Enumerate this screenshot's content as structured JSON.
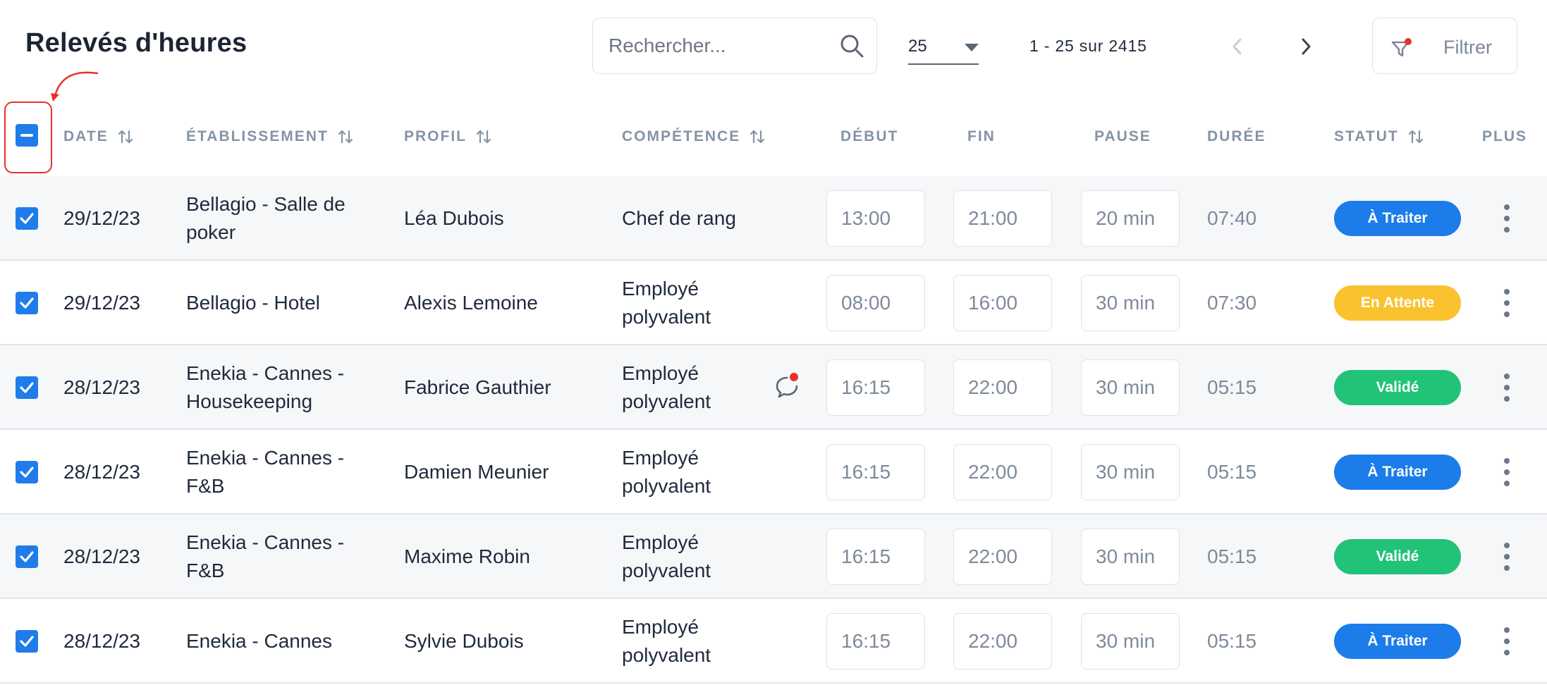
{
  "page": {
    "title": "Relevés d'heures"
  },
  "search": {
    "placeholder": "Rechercher..."
  },
  "pagination": {
    "per_page": "25",
    "range": "1 - 25 sur 2415"
  },
  "filter": {
    "label": "Filtrer"
  },
  "columns": {
    "date": "DATE",
    "etablissement": "ÉTABLISSEMENT",
    "profil": "PROFIL",
    "competence": "COMPÉTENCE",
    "debut": "DÉBUT",
    "fin": "FIN",
    "pause": "PAUSE",
    "duree": "DURÉE",
    "statut": "STATUT",
    "plus": "PLUS"
  },
  "colors": {
    "accent": "#1f7cea",
    "a_traiter": "#1b7cea",
    "en_attente": "#f9c22e",
    "valide": "#21c379",
    "annotation": "#e5322b"
  },
  "rows": [
    {
      "date": "29/12/23",
      "etab": "Bellagio - Salle de poker",
      "profil": "Léa Dubois",
      "comp": "Chef de rang",
      "debut": "13:00",
      "fin": "21:00",
      "pause": "20 min",
      "duree": "07:40",
      "statut": "À Traiter",
      "status_key": "a_traiter",
      "checked": true,
      "has_comment": false
    },
    {
      "date": "29/12/23",
      "etab": "Bellagio - Hotel",
      "profil": "Alexis Lemoine",
      "comp": "Employé polyvalent",
      "debut": "08:00",
      "fin": "16:00",
      "pause": "30 min",
      "duree": "07:30",
      "statut": "En Attente",
      "status_key": "en_attente",
      "checked": true,
      "has_comment": false
    },
    {
      "date": "28/12/23",
      "etab": "Enekia - Cannes - Housekeeping",
      "profil": "Fabrice Gauthier",
      "comp": "Employé polyvalent",
      "debut": "16:15",
      "fin": "22:00",
      "pause": "30 min",
      "duree": "05:15",
      "statut": "Validé",
      "status_key": "valide",
      "checked": true,
      "has_comment": true
    },
    {
      "date": "28/12/23",
      "etab": "Enekia - Cannes - F&B",
      "profil": "Damien Meunier",
      "comp": "Employé polyvalent",
      "debut": "16:15",
      "fin": "22:00",
      "pause": "30 min",
      "duree": "05:15",
      "statut": "À Traiter",
      "status_key": "a_traiter",
      "checked": true,
      "has_comment": false
    },
    {
      "date": "28/12/23",
      "etab": "Enekia - Cannes - F&B",
      "profil": "Maxime Robin",
      "comp": "Employé polyvalent",
      "debut": "16:15",
      "fin": "22:00",
      "pause": "30 min",
      "duree": "05:15",
      "statut": "Validé",
      "status_key": "valide",
      "checked": true,
      "has_comment": false
    },
    {
      "date": "28/12/23",
      "etab": "Enekia - Cannes",
      "profil": "Sylvie Dubois",
      "comp": "Employé polyvalent",
      "debut": "16:15",
      "fin": "22:00",
      "pause": "30 min",
      "duree": "05:15",
      "statut": "À Traiter",
      "status_key": "a_traiter",
      "checked": true,
      "has_comment": false
    }
  ]
}
